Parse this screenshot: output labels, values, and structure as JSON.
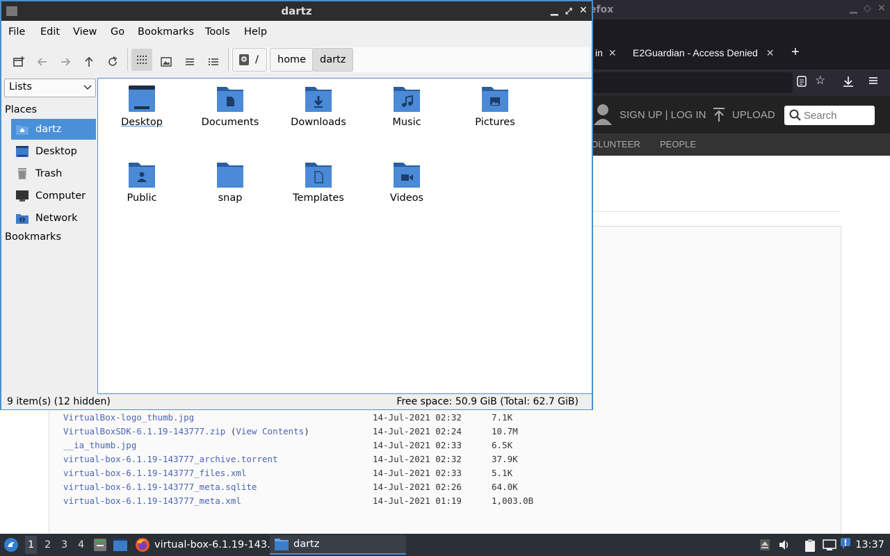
{
  "firefox": {
    "window_title": "efox",
    "tabs": [
      {
        "label": "in"
      },
      {
        "label": "E2Guardian - Access Denied"
      }
    ],
    "site_header": {
      "auth_label": "SIGN UP | LOG IN",
      "upload_label": "UPLOAD",
      "search_placeholder": "Search"
    },
    "site_nav": [
      "OLUNTEER",
      "PEOPLE"
    ],
    "files": [
      {
        "name": "VirtualBox-logo_thumb.jpg",
        "extra": "",
        "date": "14-Jul-2021 02:32",
        "size": "7.1K"
      },
      {
        "name": "VirtualBoxSDK-6.1.19-143777.zip",
        "extra": "View Contents",
        "date": "14-Jul-2021 02:24",
        "size": "10.7M"
      },
      {
        "name": "__ia_thumb.jpg",
        "extra": "",
        "date": "14-Jul-2021 02:33",
        "size": "6.5K"
      },
      {
        "name": "virtual-box-6.1.19-143777_archive.torrent",
        "extra": "",
        "date": "14-Jul-2021 02:32",
        "size": "37.9K"
      },
      {
        "name": "virtual-box-6.1.19-143777_files.xml",
        "extra": "",
        "date": "14-Jul-2021 02:33",
        "size": "5.1K"
      },
      {
        "name": "virtual-box-6.1.19-143777_meta.sqlite",
        "extra": "",
        "date": "14-Jul-2021 02:26",
        "size": "64.0K"
      },
      {
        "name": "virtual-box-6.1.19-143777_meta.xml",
        "extra": "",
        "date": "14-Jul-2021 01:19",
        "size": "1,003.0B"
      }
    ]
  },
  "file_manager": {
    "title": "dartz",
    "menu": [
      "File",
      "Edit",
      "View",
      "Go",
      "Bookmarks",
      "Tools",
      "Help"
    ],
    "breadcrumb": {
      "root": "/",
      "items": [
        "home",
        "dartz"
      ]
    },
    "sidebar": {
      "mode_select": "Lists",
      "places_heading": "Places",
      "places": [
        {
          "label": "dartz",
          "icon": "home-folder-icon",
          "selected": true
        },
        {
          "label": "Desktop",
          "icon": "desktop-icon",
          "selected": false
        },
        {
          "label": "Trash",
          "icon": "trash-icon",
          "selected": false
        },
        {
          "label": "Computer",
          "icon": "computer-icon",
          "selected": false
        },
        {
          "label": "Network",
          "icon": "network-icon",
          "selected": false
        }
      ],
      "bookmarks_heading": "Bookmarks"
    },
    "folders": [
      {
        "label": "Desktop",
        "emblem": "desktop"
      },
      {
        "label": "Documents",
        "emblem": "documents"
      },
      {
        "label": "Downloads",
        "emblem": "downloads"
      },
      {
        "label": "Music",
        "emblem": "music"
      },
      {
        "label": "Pictures",
        "emblem": "pictures"
      },
      {
        "label": "Public",
        "emblem": "public"
      },
      {
        "label": "snap",
        "emblem": "none"
      },
      {
        "label": "Templates",
        "emblem": "templates"
      },
      {
        "label": "Videos",
        "emblem": "videos"
      }
    ],
    "status": {
      "items": "9 item(s) (12 hidden)",
      "free_space": "Free space: 50.9 GiB (Total: 62.7 GiB)"
    }
  },
  "taskbar": {
    "workspaces": [
      "1",
      "2",
      "3",
      "4"
    ],
    "tasks": [
      {
        "label": "virtual-box-6.1.19-143...",
        "icon": "firefox-icon"
      },
      {
        "label": "dartz",
        "icon": "folder-icon"
      }
    ],
    "clock": "13:37"
  },
  "colors": {
    "folder_blue": "#4a8ad6",
    "folder_dark": "#2a5d9e",
    "selection": "#4a90d9",
    "link": "#4b64b4"
  }
}
